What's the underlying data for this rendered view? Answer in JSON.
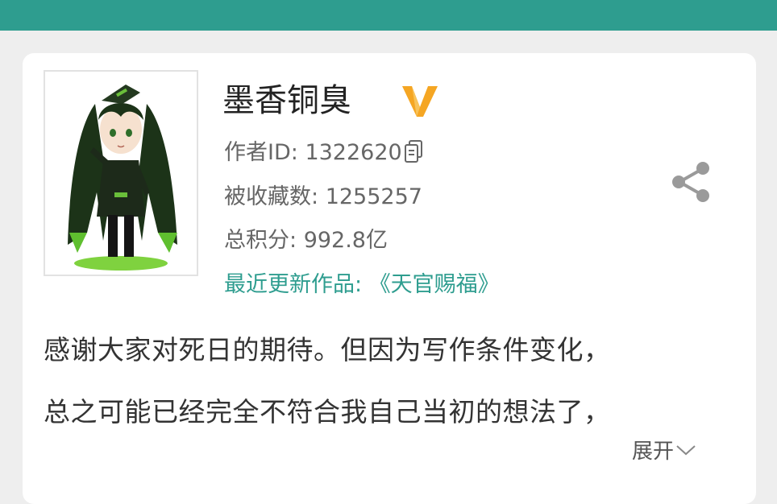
{
  "header": {
    "bar_color": "#2e9d8f"
  },
  "author": {
    "name": "墨香铜臭",
    "vip_icon": "v-badge-icon",
    "id_label": "作者ID: ",
    "id_value": "1322620",
    "favorites_label": "被收藏数: ",
    "favorites_value": "1255257",
    "score_label": "总积分:  ",
    "score_value": "992.8亿",
    "recent_label": "最近更新作品:  ",
    "recent_value": "《天官赐福》"
  },
  "description": {
    "line1": "感谢大家对死日的期待。但因为写作条件变化，",
    "line2": "总之可能已经完全不符合我自己当初的想法了，",
    "expand_label": "展开"
  },
  "icons": {
    "copy": "copy-icon",
    "share": "share-icon",
    "expand": "chevron-down-icon"
  },
  "colors": {
    "accent": "#2e9d8f",
    "vip": "#f5a623"
  }
}
